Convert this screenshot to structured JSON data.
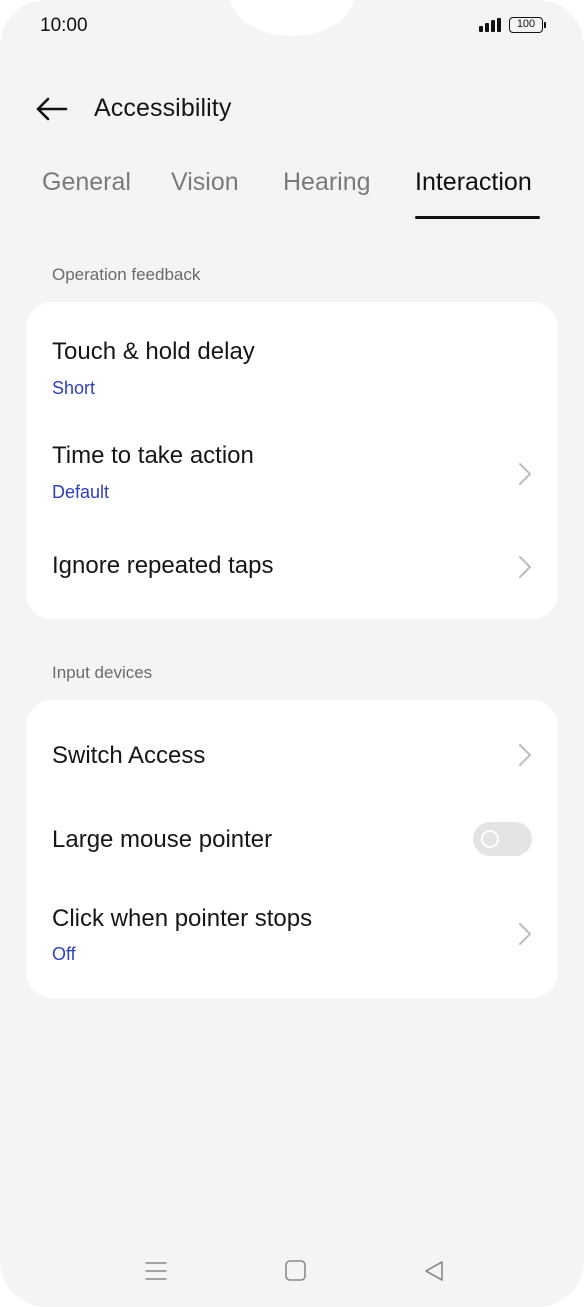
{
  "status_bar": {
    "time": "10:00",
    "battery": "100"
  },
  "header": {
    "back_icon": "arrow-left-icon",
    "title": "Accessibility"
  },
  "tabs": [
    {
      "label": "General",
      "active": false
    },
    {
      "label": "Vision",
      "active": false
    },
    {
      "label": "Hearing",
      "active": false
    },
    {
      "label": "Interaction",
      "active": true
    }
  ],
  "sections": [
    {
      "header": "Operation feedback",
      "items": [
        {
          "title": "Touch & hold delay",
          "value": "Short"
        },
        {
          "title": "Time to take action",
          "value": "Default",
          "chevron": true
        },
        {
          "title": "Ignore repeated taps",
          "chevron": true
        }
      ]
    },
    {
      "header": "Input devices",
      "items": [
        {
          "title": "Switch Access",
          "chevron": true
        },
        {
          "title": "Large mouse pointer",
          "toggle": false
        },
        {
          "title": "Click when pointer stops",
          "value": "Off",
          "chevron": true
        }
      ]
    }
  ],
  "navigation_bar": {
    "buttons": [
      "menu-icon",
      "home-icon",
      "back-triangle-icon"
    ]
  },
  "colors": {
    "background": "#f4f4f4",
    "card": "#ffffff",
    "accent_value": "#2f3fc0",
    "toggle_off": "#e3e3e3"
  }
}
